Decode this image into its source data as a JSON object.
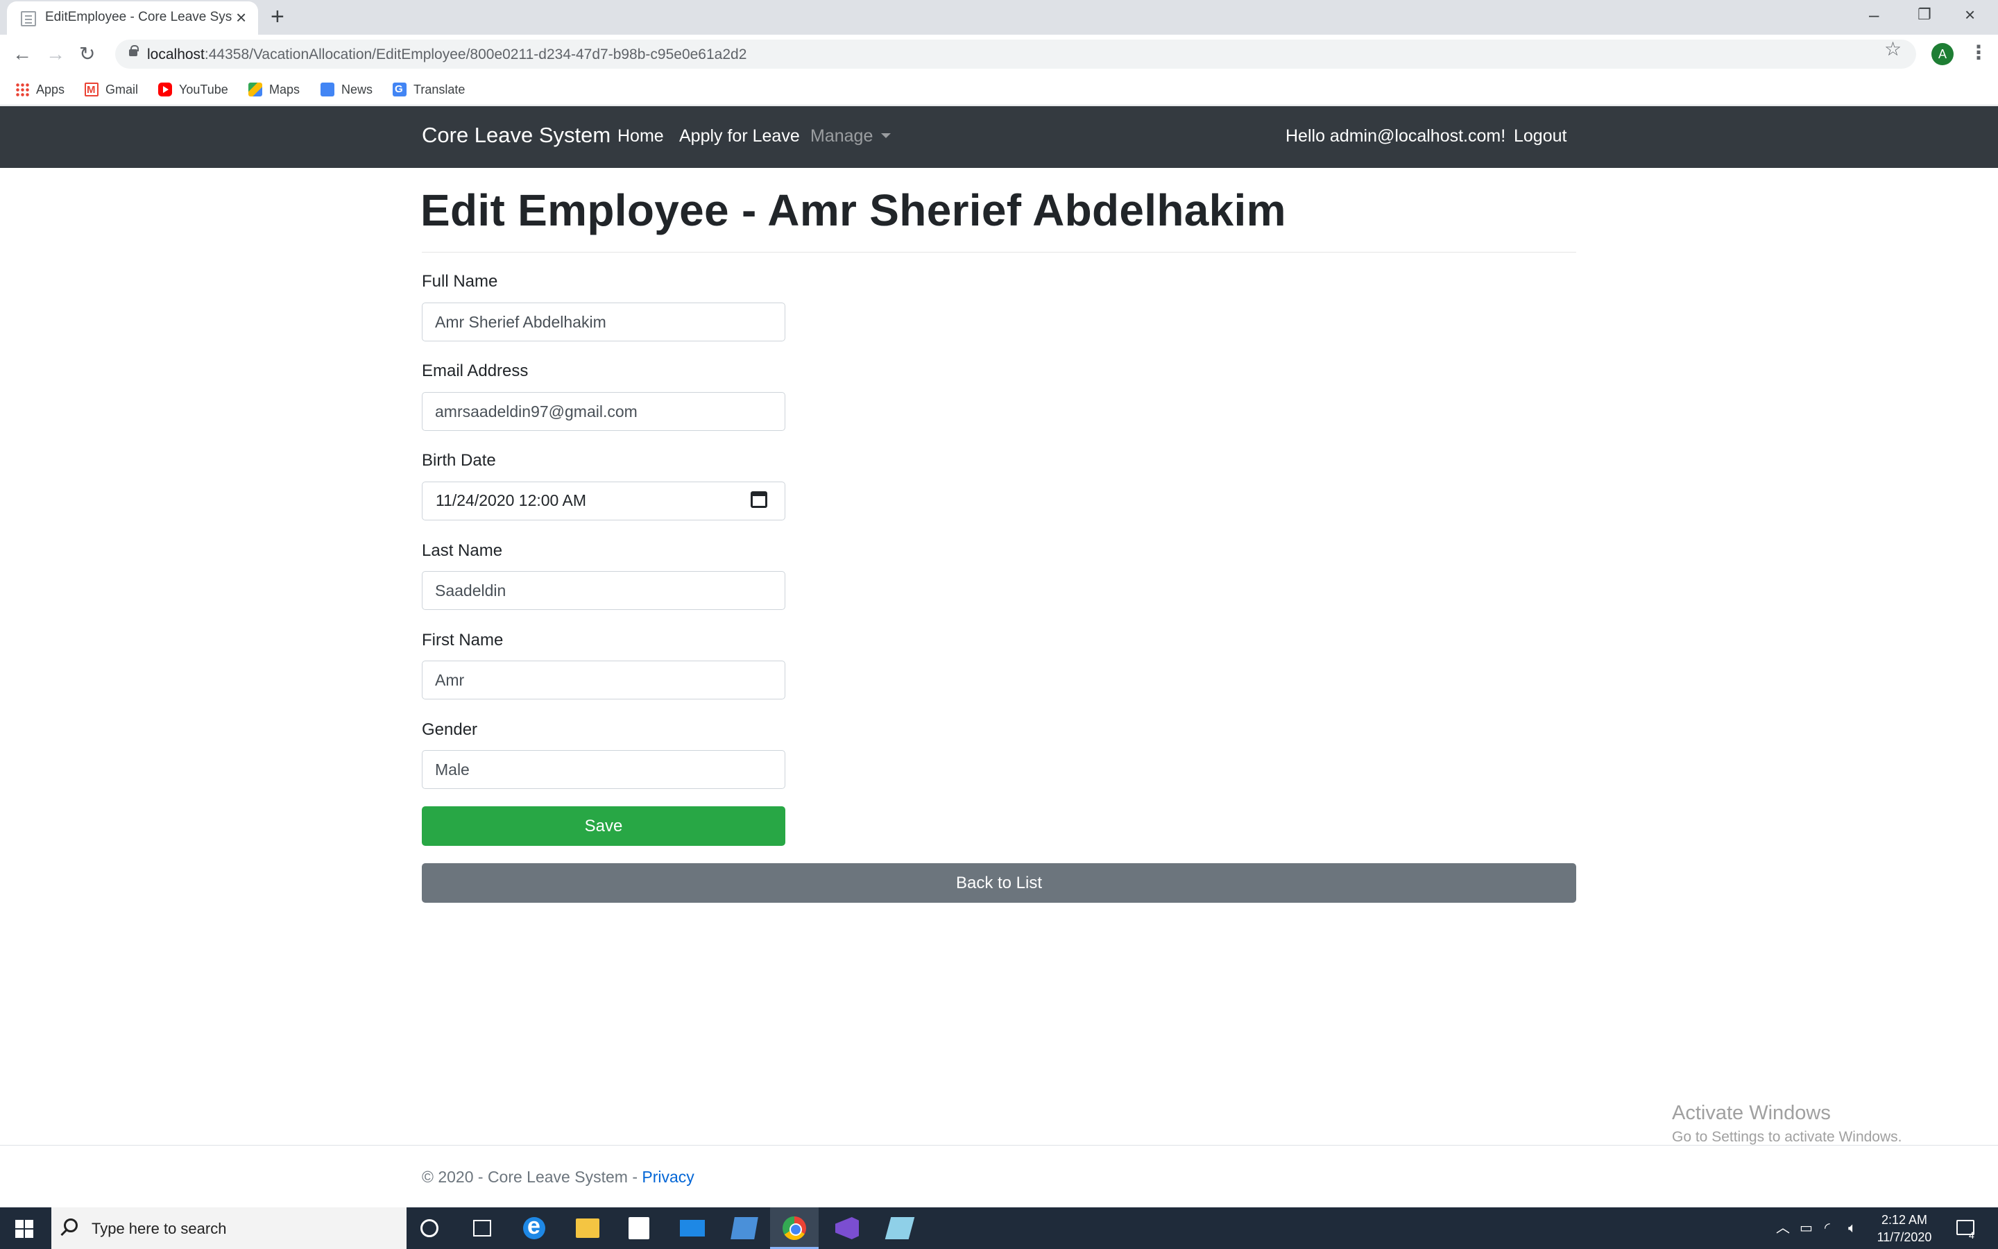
{
  "browser": {
    "tab_title": "EditEmployee - Core Leave Syste",
    "url_host": "localhost",
    "url_path": ":44358/VacationAllocation/EditEmployee/800e0211-d234-47d7-b98b-c95e0e61a2d2",
    "profile_initial": "A",
    "bookmarks": [
      "Apps",
      "Gmail",
      "YouTube",
      "Maps",
      "News",
      "Translate"
    ]
  },
  "navbar": {
    "brand": "Core Leave System",
    "links": [
      "Home",
      "Apply for Leave",
      "Manage"
    ],
    "greeting": "Hello admin@localhost.com!",
    "logout": "Logout"
  },
  "page": {
    "title": "Edit Employee - Amr Sherief Abdelhakim"
  },
  "form": {
    "full_name": {
      "label": "Full Name",
      "value": "Amr Sherief Abdelhakim"
    },
    "email": {
      "label": "Email Address",
      "value": "amrsaadeldin97@gmail.com"
    },
    "birth_date": {
      "label": "Birth Date",
      "value": "11/24/2020  12:00  AM"
    },
    "last_name": {
      "label": "Last Name",
      "value": "Saadeldin"
    },
    "first_name": {
      "label": "First Name",
      "value": "Amr"
    },
    "gender": {
      "label": "Gender",
      "value": "Male"
    },
    "save_label": "Save",
    "back_label": "Back to List"
  },
  "watermark": {
    "line1": "Activate Windows",
    "line2": "Go to Settings to activate Windows."
  },
  "footer": {
    "text": "© 2020 - Core Leave System - ",
    "privacy": "Privacy"
  },
  "taskbar": {
    "search_placeholder": "Type here to search",
    "time": "2:12 AM",
    "date": "11/7/2020",
    "notification_count": "4"
  }
}
